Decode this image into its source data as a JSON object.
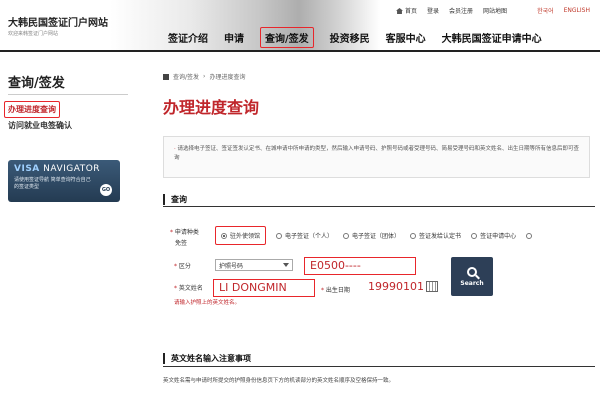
{
  "header": {
    "logo_title": "大韩民国签证门户网站",
    "logo_sub": "欢迎来韩签证门户网站",
    "topbar": {
      "home": "首页",
      "login": "登录",
      "register": "会员注册",
      "sitemap": "网站地图",
      "korean": "한국어",
      "english": "ENGLISH"
    },
    "nav": [
      "签证介绍",
      "申请",
      "查询/签发",
      "投资移民",
      "客服中心",
      "大韩民国签证申请中心"
    ],
    "active_nav_index": 2
  },
  "sidebar": {
    "title": "查询/签发",
    "items": [
      "办理进度查询",
      "访问就业电签确认"
    ],
    "banner": {
      "visa": "VISA",
      "navigator": "NAVIGATOR",
      "sub": "请使用签证导航 简单查询符合自己的签证类型",
      "go": "GO"
    }
  },
  "main": {
    "breadcrumb": [
      "查询/签发",
      "办理进度查询"
    ],
    "title": "办理进度查询",
    "notice": "请选择电子签证、签证签发认定书、在城申请中所申请的类型，然后输入申请号码、护照号码或者受理号码、简易受理号码和英文姓名、出生日期等所有信息后即可查询",
    "section_head": "查询",
    "form": {
      "type_label": "申请种类",
      "type_label2": "免签",
      "types": [
        "驻外使领馆",
        "电子签证（个人）",
        "电子签证（团体）",
        "签证发给认定书",
        "签证申请中心"
      ],
      "selected_type": 0,
      "division_label": "区分",
      "division_value": "护照号码",
      "passport_value": "E0500----",
      "name_label": "英文姓名",
      "name_value": "LI DONGMIN",
      "birth_label": "出生日期",
      "birth_value": "19990101",
      "search": "Search",
      "hint": "请输入护照上的英文姓名。"
    },
    "section2_head": "英文姓名输入注意事项",
    "section2_text": "英文姓名需与申请时所提交的护照身份信息页下方的机读部分的英文姓名顺序及空格保持一致。"
  }
}
